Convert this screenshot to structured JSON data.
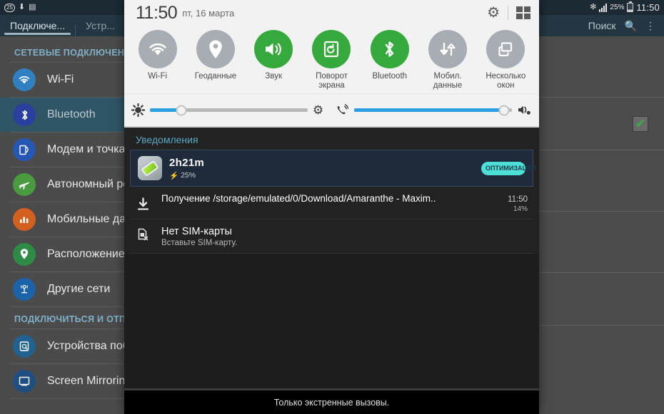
{
  "background_app": {
    "statusbar": {
      "left_icons": [
        "badge-25-icon",
        "download-icon",
        "no-sim-icon"
      ],
      "badge_count": "25",
      "bluetooth_icon": "bluetooth-icon",
      "signal_icon": "signal-bars-icon",
      "battery_percent": "25%",
      "clock": "11:50"
    },
    "actionbar": {
      "tabs": [
        {
          "label": "Подключе...",
          "active": true
        },
        {
          "label": "Устр...",
          "active": false
        }
      ],
      "search_label": "Поиск",
      "search_icon": "search-icon",
      "overflow_icon": "overflow-menu-icon"
    },
    "sidebar": {
      "sections": [
        {
          "title": "СЕТЕВЫЕ ПОДКЛЮЧЕНИЯ",
          "items": [
            {
              "label": "Wi-Fi",
              "icon": "wifi-icon",
              "color": "#2f7fc1",
              "selected": false
            },
            {
              "label": "Bluetooth",
              "icon": "bluetooth-icon",
              "color": "#2b3f9e",
              "selected": true
            },
            {
              "label": "Модем и точка доступа",
              "icon": "tethering-icon",
              "color": "#2558b5",
              "selected": false
            },
            {
              "label": "Автономный режим",
              "icon": "airplane-icon",
              "color": "#4a9b3f",
              "selected": false
            },
            {
              "label": "Мобильные данные",
              "icon": "data-usage-icon",
              "color": "#d4601f",
              "selected": false
            },
            {
              "label": "Расположение",
              "icon": "location-pin-icon",
              "color": "#2e8b45",
              "selected": false
            },
            {
              "label": "Другие сети",
              "icon": "more-networks-icon",
              "color": "#1c62a8",
              "selected": false
            }
          ]
        },
        {
          "title": "ПОДКЛЮЧИТЬСЯ И ОТПРАВИТЬ",
          "items": [
            {
              "label": "Устройства поблизости",
              "icon": "nearby-devices-icon",
              "color": "#20618f",
              "selected": false
            },
            {
              "label": "Screen Mirroring",
              "icon": "screen-mirroring-icon",
              "color": "#1e4f80",
              "selected": false
            }
          ]
        }
      ]
    },
    "main": {
      "checkbox_checked_icon": "checkmark-icon",
      "partial_text": "ны."
    }
  },
  "notification_panel": {
    "header": {
      "clock": "11:50",
      "date": "пт, 16 марта",
      "settings_icon": "gear-icon",
      "multiwindow_icon": "multi-window-icon"
    },
    "toggles": [
      {
        "label": "Wi-Fi",
        "icon": "wifi-icon",
        "on": false
      },
      {
        "label": "Геоданные",
        "icon": "location-pin-icon",
        "on": false
      },
      {
        "label": "Звук",
        "icon": "sound-icon",
        "on": true
      },
      {
        "label": "Поворот экрана",
        "icon": "rotate-screen-icon",
        "on": true
      },
      {
        "label": "Bluetooth",
        "icon": "bluetooth-icon",
        "on": true
      },
      {
        "label": "Мобил. данные",
        "icon": "mobile-data-icon",
        "on": false
      },
      {
        "label": "Несколько окон",
        "icon": "multi-window-icon",
        "on": false
      }
    ],
    "sliders": [
      {
        "name": "brightness",
        "left_icon": "brightness-icon",
        "right_icon": "auto-brightness-gear-icon",
        "value_percent": 20,
        "fill_color": "#2b9fe0"
      },
      {
        "name": "volume",
        "left_icon": "ringtone-icon",
        "right_icon": "volume-settings-icon",
        "value_percent": 95,
        "fill_color": "#2b9fe0"
      }
    ],
    "notifications": {
      "title": "Уведомления",
      "battery_card": {
        "icon": "battery-optimization-icon",
        "time_remaining": "2h21m",
        "charge_icon": "bolt-icon",
        "charge_percent": "25%",
        "action_label": "ОПТИМИЗАЦИЯ",
        "action_color": "#4ee0d8"
      },
      "download": {
        "icon": "download-icon",
        "title": "Получение /storage/emulated/0/Download/Amaranthe - Maxim..",
        "time": "11:50",
        "progress_percent": 14,
        "progress_label": "14%",
        "fill_color": "#2b9fe0"
      },
      "sim": {
        "icon": "no-sim-icon",
        "title": "Нет SIM-карты",
        "subtitle": "Вставьте SIM-карту."
      }
    },
    "bottom_bar": {
      "text": "Только экстренные вызовы."
    }
  }
}
